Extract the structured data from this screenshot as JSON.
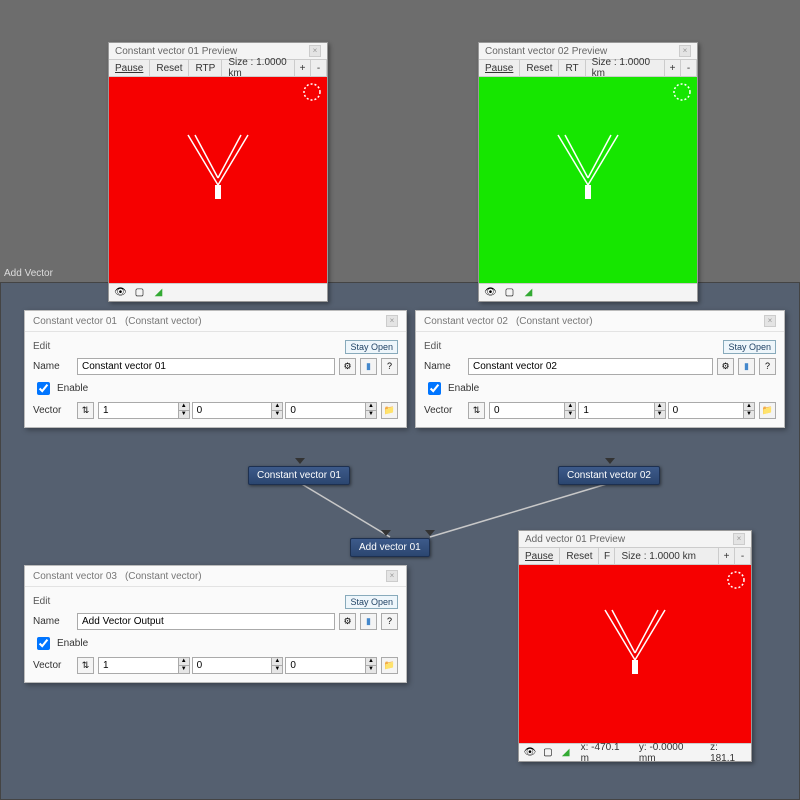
{
  "graph": {
    "tab_label": "Add Vector",
    "nodes": {
      "cv1": "Constant vector 01",
      "cv2": "Constant vector 02",
      "add": "Add vector 01"
    }
  },
  "preview": {
    "pause": "Pause",
    "reset": "Reset",
    "rtp": "RTP",
    "rt": "RT",
    "f": "F",
    "size_label": "Size : 1.0000 km",
    "plus": "+",
    "minus": "-"
  },
  "panel1": {
    "title": "Constant vector 01 Preview",
    "color": "#f60000"
  },
  "panel2": {
    "title": "Constant vector 02 Preview",
    "color": "#16e600"
  },
  "panel3": {
    "title": "Add vector 01 Preview",
    "color": "#f60000",
    "coords": {
      "x": "x: -470.1 m",
      "y": "y: -0.0000 mm",
      "z": "z: 181.1"
    }
  },
  "insp": {
    "edit": "Edit",
    "stay_open": "Stay Open",
    "name_label": "Name",
    "enable": "Enable",
    "vector_label": "Vector",
    "slider": "⇅",
    "gear": "⚙",
    "help": "?",
    "sub": "(Constant vector)"
  },
  "insp1": {
    "title": "Constant vector 01",
    "name": "Constant vector 01",
    "x": "1",
    "y": "0",
    "z": "0"
  },
  "insp2": {
    "title": "Constant vector 02",
    "name": "Constant vector 02",
    "x": "0",
    "y": "1",
    "z": "0"
  },
  "insp3": {
    "title": "Constant vector 03",
    "name": "Add Vector Output",
    "x": "1",
    "y": "0",
    "z": "0"
  }
}
